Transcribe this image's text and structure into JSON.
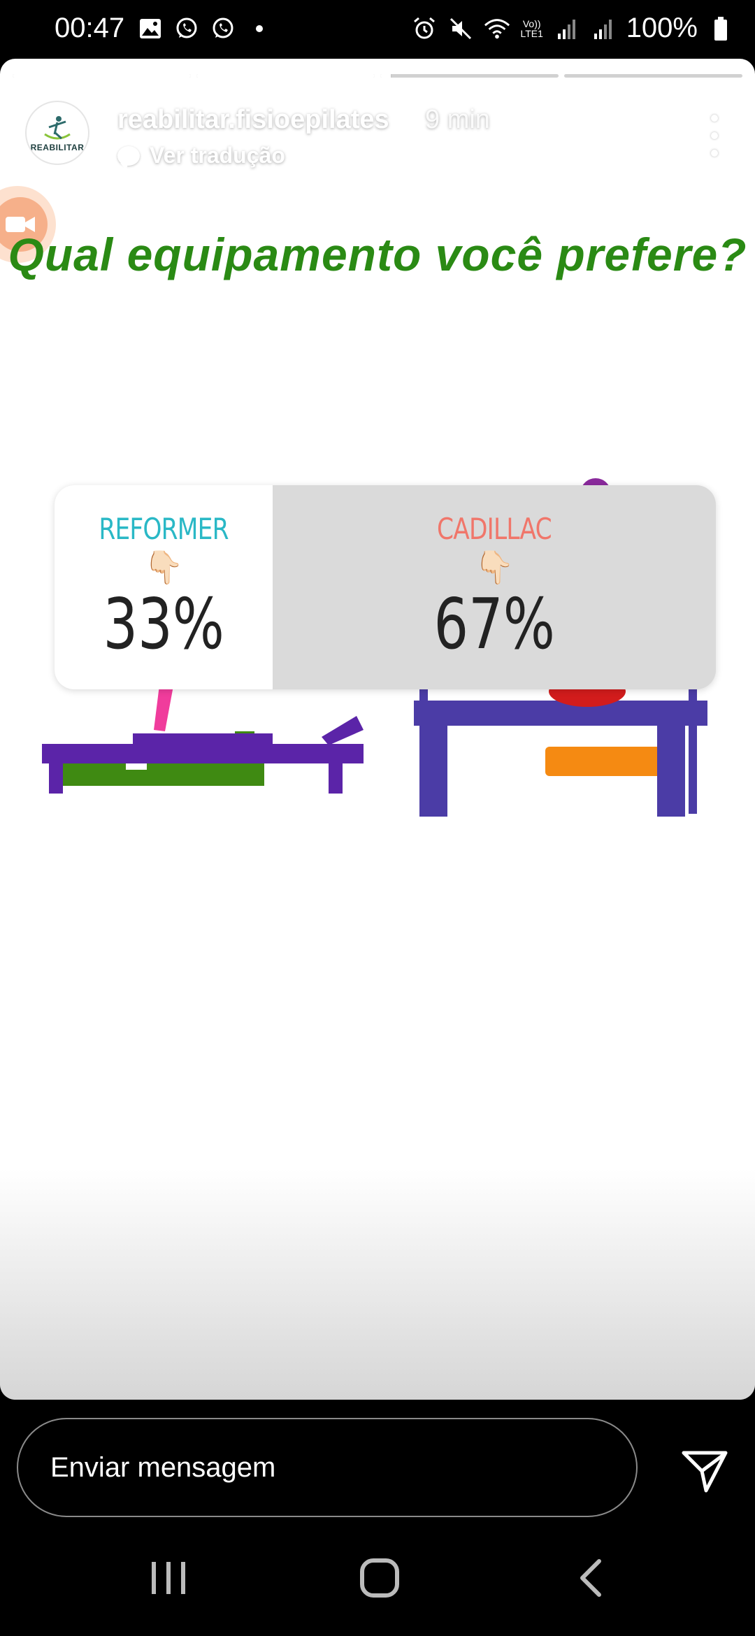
{
  "status_bar": {
    "time": "00:47",
    "battery": "100%",
    "left_icons": [
      "gallery-icon",
      "whatsapp-icon",
      "whatsapp-icon",
      "dot-icon"
    ],
    "right_icons": [
      "alarm-icon",
      "mute-icon",
      "wifi-icon",
      "volte-icon",
      "signal-icon",
      "signal-icon",
      "battery-icon"
    ],
    "volte_label": "Vo)) LTE1"
  },
  "story": {
    "progress": [
      1,
      1,
      0.06,
      0
    ],
    "account": {
      "username": "reabilitar.fisioepilates",
      "time_ago": "9 min",
      "translate_label": "Ver tradução",
      "avatar_brand": "REABILITAR"
    },
    "question": "Qual equipamento você prefere?",
    "poll": {
      "options": [
        {
          "label": "REFORMER",
          "emoji": "👇🏻",
          "percent": "33%",
          "share": 0.33,
          "color": "#2ab8c6",
          "selected": true
        },
        {
          "label": "CADILLAC",
          "emoji": "👇🏻",
          "percent": "67%",
          "share": 0.67,
          "color": "#f0766a",
          "selected": false
        }
      ]
    },
    "colors": {
      "question": "#2a8a14"
    }
  },
  "message_bar": {
    "placeholder": "Enviar mensagem"
  },
  "nav_bar": {
    "buttons": [
      "recents-icon",
      "home-icon",
      "back-icon"
    ]
  }
}
